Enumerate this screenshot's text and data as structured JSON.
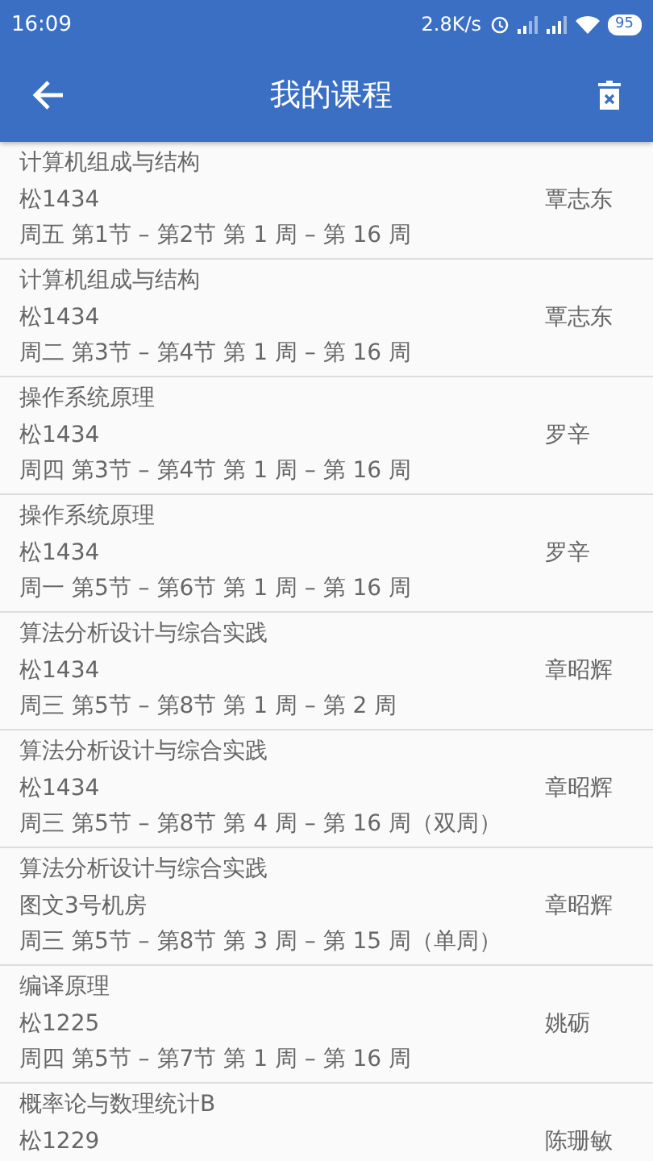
{
  "status_bar": {
    "time": "16:09",
    "speed": "2.8K/s",
    "battery": "95"
  },
  "app_bar": {
    "title": "我的课程"
  },
  "courses": [
    {
      "name": "计算机组成与结构",
      "room": "松1434",
      "teacher": "覃志东",
      "time": "周五 第1节 – 第2节 第 1 周 – 第 16 周"
    },
    {
      "name": "计算机组成与结构",
      "room": "松1434",
      "teacher": "覃志东",
      "time": "周二 第3节 – 第4节 第 1 周 – 第 16 周"
    },
    {
      "name": "操作系统原理",
      "room": "松1434",
      "teacher": "罗辛",
      "time": "周四 第3节 – 第4节 第 1 周 – 第 16 周"
    },
    {
      "name": "操作系统原理",
      "room": "松1434",
      "teacher": "罗辛",
      "time": "周一 第5节 – 第6节 第 1 周 – 第 16 周"
    },
    {
      "name": "算法分析设计与综合实践",
      "room": "松1434",
      "teacher": "章昭辉",
      "time": "周三 第5节 – 第8节 第 1 周 – 第 2 周"
    },
    {
      "name": "算法分析设计与综合实践",
      "room": "松1434",
      "teacher": "章昭辉",
      "time": "周三 第5节 – 第8节 第 4 周 – 第 16 周（双周）"
    },
    {
      "name": "算法分析设计与综合实践",
      "room": "图文3号机房",
      "teacher": "章昭辉",
      "time": "周三 第5节 – 第8节 第 3 周 – 第 15 周（单周）"
    },
    {
      "name": "编译原理",
      "room": "松1225",
      "teacher": "姚砺",
      "time": "周四 第5节 – 第7节 第 1 周 – 第 16 周"
    },
    {
      "name": "概率论与数理统计B",
      "room": "松1229",
      "teacher": "陈珊敏"
    }
  ]
}
